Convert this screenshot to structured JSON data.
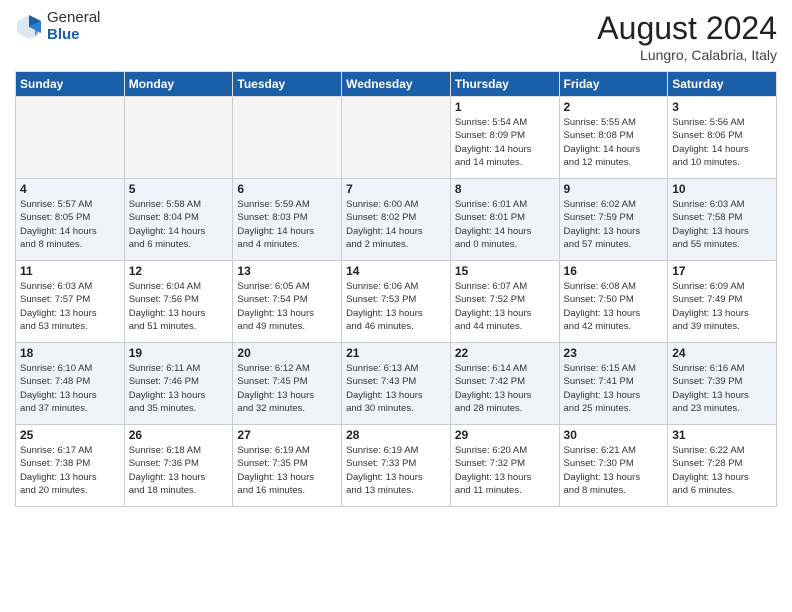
{
  "header": {
    "logo_general": "General",
    "logo_blue": "Blue",
    "title": "August 2024",
    "location": "Lungro, Calabria, Italy"
  },
  "days_of_week": [
    "Sunday",
    "Monday",
    "Tuesday",
    "Wednesday",
    "Thursday",
    "Friday",
    "Saturday"
  ],
  "weeks": [
    [
      {
        "day": "",
        "info": ""
      },
      {
        "day": "",
        "info": ""
      },
      {
        "day": "",
        "info": ""
      },
      {
        "day": "",
        "info": ""
      },
      {
        "day": "1",
        "info": "Sunrise: 5:54 AM\nSunset: 8:09 PM\nDaylight: 14 hours\nand 14 minutes."
      },
      {
        "day": "2",
        "info": "Sunrise: 5:55 AM\nSunset: 8:08 PM\nDaylight: 14 hours\nand 12 minutes."
      },
      {
        "day": "3",
        "info": "Sunrise: 5:56 AM\nSunset: 8:06 PM\nDaylight: 14 hours\nand 10 minutes."
      }
    ],
    [
      {
        "day": "4",
        "info": "Sunrise: 5:57 AM\nSunset: 8:05 PM\nDaylight: 14 hours\nand 8 minutes."
      },
      {
        "day": "5",
        "info": "Sunrise: 5:58 AM\nSunset: 8:04 PM\nDaylight: 14 hours\nand 6 minutes."
      },
      {
        "day": "6",
        "info": "Sunrise: 5:59 AM\nSunset: 8:03 PM\nDaylight: 14 hours\nand 4 minutes."
      },
      {
        "day": "7",
        "info": "Sunrise: 6:00 AM\nSunset: 8:02 PM\nDaylight: 14 hours\nand 2 minutes."
      },
      {
        "day": "8",
        "info": "Sunrise: 6:01 AM\nSunset: 8:01 PM\nDaylight: 14 hours\nand 0 minutes."
      },
      {
        "day": "9",
        "info": "Sunrise: 6:02 AM\nSunset: 7:59 PM\nDaylight: 13 hours\nand 57 minutes."
      },
      {
        "day": "10",
        "info": "Sunrise: 6:03 AM\nSunset: 7:58 PM\nDaylight: 13 hours\nand 55 minutes."
      }
    ],
    [
      {
        "day": "11",
        "info": "Sunrise: 6:03 AM\nSunset: 7:57 PM\nDaylight: 13 hours\nand 53 minutes."
      },
      {
        "day": "12",
        "info": "Sunrise: 6:04 AM\nSunset: 7:56 PM\nDaylight: 13 hours\nand 51 minutes."
      },
      {
        "day": "13",
        "info": "Sunrise: 6:05 AM\nSunset: 7:54 PM\nDaylight: 13 hours\nand 49 minutes."
      },
      {
        "day": "14",
        "info": "Sunrise: 6:06 AM\nSunset: 7:53 PM\nDaylight: 13 hours\nand 46 minutes."
      },
      {
        "day": "15",
        "info": "Sunrise: 6:07 AM\nSunset: 7:52 PM\nDaylight: 13 hours\nand 44 minutes."
      },
      {
        "day": "16",
        "info": "Sunrise: 6:08 AM\nSunset: 7:50 PM\nDaylight: 13 hours\nand 42 minutes."
      },
      {
        "day": "17",
        "info": "Sunrise: 6:09 AM\nSunset: 7:49 PM\nDaylight: 13 hours\nand 39 minutes."
      }
    ],
    [
      {
        "day": "18",
        "info": "Sunrise: 6:10 AM\nSunset: 7:48 PM\nDaylight: 13 hours\nand 37 minutes."
      },
      {
        "day": "19",
        "info": "Sunrise: 6:11 AM\nSunset: 7:46 PM\nDaylight: 13 hours\nand 35 minutes."
      },
      {
        "day": "20",
        "info": "Sunrise: 6:12 AM\nSunset: 7:45 PM\nDaylight: 13 hours\nand 32 minutes."
      },
      {
        "day": "21",
        "info": "Sunrise: 6:13 AM\nSunset: 7:43 PM\nDaylight: 13 hours\nand 30 minutes."
      },
      {
        "day": "22",
        "info": "Sunrise: 6:14 AM\nSunset: 7:42 PM\nDaylight: 13 hours\nand 28 minutes."
      },
      {
        "day": "23",
        "info": "Sunrise: 6:15 AM\nSunset: 7:41 PM\nDaylight: 13 hours\nand 25 minutes."
      },
      {
        "day": "24",
        "info": "Sunrise: 6:16 AM\nSunset: 7:39 PM\nDaylight: 13 hours\nand 23 minutes."
      }
    ],
    [
      {
        "day": "25",
        "info": "Sunrise: 6:17 AM\nSunset: 7:38 PM\nDaylight: 13 hours\nand 20 minutes."
      },
      {
        "day": "26",
        "info": "Sunrise: 6:18 AM\nSunset: 7:36 PM\nDaylight: 13 hours\nand 18 minutes."
      },
      {
        "day": "27",
        "info": "Sunrise: 6:19 AM\nSunset: 7:35 PM\nDaylight: 13 hours\nand 16 minutes."
      },
      {
        "day": "28",
        "info": "Sunrise: 6:19 AM\nSunset: 7:33 PM\nDaylight: 13 hours\nand 13 minutes."
      },
      {
        "day": "29",
        "info": "Sunrise: 6:20 AM\nSunset: 7:32 PM\nDaylight: 13 hours\nand 11 minutes."
      },
      {
        "day": "30",
        "info": "Sunrise: 6:21 AM\nSunset: 7:30 PM\nDaylight: 13 hours\nand 8 minutes."
      },
      {
        "day": "31",
        "info": "Sunrise: 6:22 AM\nSunset: 7:28 PM\nDaylight: 13 hours\nand 6 minutes."
      }
    ]
  ]
}
